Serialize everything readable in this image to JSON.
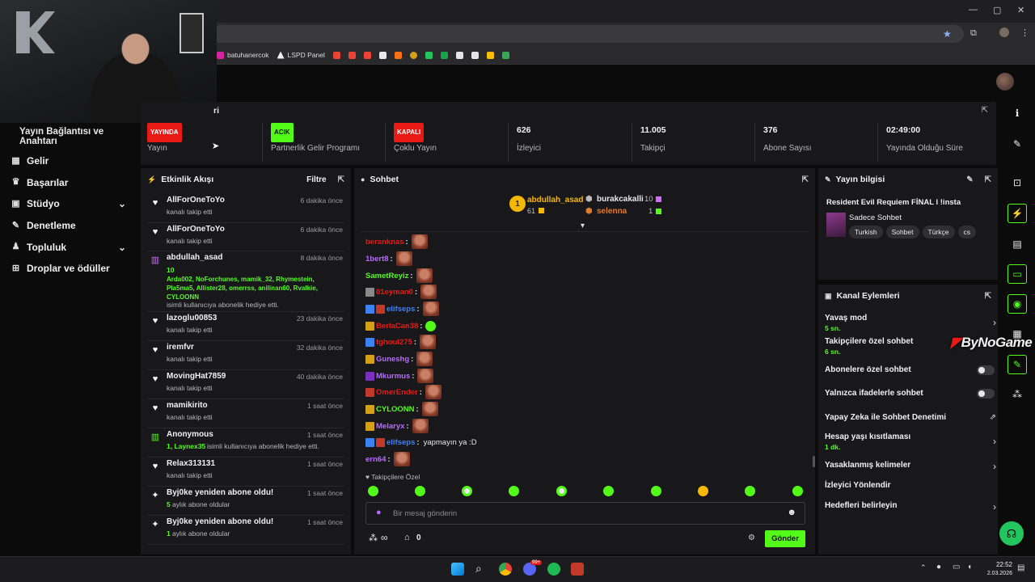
{
  "browser": {
    "bookmarks": [
      "batuhanercok",
      "LSPD Panel"
    ]
  },
  "sidebar": {
    "header": "Yayın Bağlantısı ve Anahtarı",
    "items": [
      {
        "label": "Gelir",
        "icon": "revenue-icon"
      },
      {
        "label": "Başarılar",
        "icon": "trophy-icon"
      },
      {
        "label": "Stüdyo",
        "icon": "studio-icon",
        "expandable": true
      },
      {
        "label": "Denetleme",
        "icon": "wrench-icon"
      },
      {
        "label": "Topluluk",
        "icon": "community-icon",
        "expandable": true
      },
      {
        "label": "Droplar ve ödüller",
        "icon": "gift-icon"
      }
    ]
  },
  "stats": {
    "header_partial": "ri",
    "items": [
      {
        "badge": "YAYINDA",
        "badge_color": "#e91916",
        "label": "Yayın"
      },
      {
        "badge": "ACIK",
        "badge_color": "#53fc18",
        "label": "Partnerlik Gelir Programı"
      },
      {
        "badge": "KAPALI",
        "badge_color": "#e91916",
        "label": "Çoklu Yayın"
      },
      {
        "value": "626",
        "label": "İzleyici"
      },
      {
        "value": "11.005",
        "label": "Takipçi"
      },
      {
        "value": "376",
        "label": "Abone Sayısı"
      },
      {
        "value": "02:49:00",
        "label": "Yayında Olduğu Süre"
      }
    ]
  },
  "activity": {
    "title": "Etkinlik Akışı",
    "filter": "Filtre",
    "items": [
      {
        "name": "AllForOneToYo",
        "time": "6 dakika önce",
        "sub": "kanalı takip etti",
        "icon": "heart-icon"
      },
      {
        "name": "AllForOneToYo",
        "time": "6 dakika önce",
        "sub": "kanalı takip etti",
        "icon": "heart-icon"
      },
      {
        "name": "abdullah_asad",
        "time": "8 dakika önce",
        "count": "10",
        "names": "Arda002, NoForchunes, mamik_32, Rhymestein, Pla5ma5, Allister28, omerrss, anilinan60, Rvalkie, CYLOONN",
        "sub": "isimli kullanıcıya abonelik hediye etti.",
        "icon": "gift-icon"
      },
      {
        "name": "lazoglu00853",
        "time": "23 dakika önce",
        "sub": "kanalı takip etti",
        "icon": "heart-icon"
      },
      {
        "name": "iremfvr",
        "time": "32 dakika önce",
        "sub": "kanalı takip etti",
        "icon": "heart-icon"
      },
      {
        "name": "MovingHat7859",
        "time": "40 dakika önce",
        "sub": "kanalı takip etti",
        "icon": "heart-icon"
      },
      {
        "name": "mamikirito",
        "time": "1 saat önce",
        "sub": "kanalı takip etti",
        "icon": "heart-icon"
      },
      {
        "name": "Anonymous",
        "time": "1 saat önce",
        "highlight": "1, Laynex35",
        "sub": "isimli kullanıcıya abonelik hediye etti.",
        "icon": "gift-icon"
      },
      {
        "name": "Relax313131",
        "time": "1 saat önce",
        "sub": "kanalı takip etti",
        "icon": "heart-icon"
      },
      {
        "name": "Byj0ke yeniden abone oldu!",
        "time": "1 saat önce",
        "highlight": "5",
        "sub": "aylık abone oldular",
        "icon": "sparkle-icon"
      },
      {
        "name": "Byj0ke yeniden abone oldu!",
        "time": "1 saat önce",
        "highlight": "1",
        "sub": "aylık abone oldular",
        "icon": "sparkle-icon"
      }
    ]
  },
  "chat": {
    "title": "Sohbet",
    "leaders": [
      {
        "rank": "1",
        "name": "abdullah_asad",
        "count": "61"
      },
      {
        "name": "burakcakalli",
        "count": "10"
      },
      {
        "name": "selenna",
        "count": "1"
      }
    ],
    "messages": [
      {
        "user": "beranknas",
        "color": "#e91916",
        "emote": true
      },
      {
        "user": "1bert8",
        "color": "#b66bff",
        "emote": true
      },
      {
        "user": "SametReyiz",
        "color": "#53fc18",
        "emote": true
      },
      {
        "user": "01eyman0",
        "color": "#e91916",
        "emote": true,
        "badges": [
          "#8a8a8a"
        ]
      },
      {
        "user": "elifseps",
        "color": "#3b82f6",
        "emote": true,
        "badges": [
          "#3b82f6",
          "#c0392b"
        ]
      },
      {
        "user": "BerlaCan38",
        "color": "#e91916",
        "emote": true,
        "badges": [
          "#d4a017"
        ]
      },
      {
        "user": "tghoul275",
        "color": "#e91916",
        "emote": true,
        "badges": [
          "#3b82f6"
        ]
      },
      {
        "user": "Guneshg",
        "color": "#b66bff",
        "emote": true,
        "badges": [
          "#d4a017"
        ]
      },
      {
        "user": "Mkurmus",
        "color": "#b66bff",
        "emote": true,
        "badges": [
          "#7b2fbe"
        ]
      },
      {
        "user": "OmerEnder",
        "color": "#e91916",
        "emote": true,
        "badges": [
          "#c0392b"
        ]
      },
      {
        "user": "CYLOONN",
        "color": "#53fc18",
        "emote": true,
        "badges": [
          "#d4a017"
        ]
      },
      {
        "user": "Melaryx",
        "color": "#b66bff",
        "emote": true,
        "badges": [
          "#d4a017"
        ]
      },
      {
        "user": "elifseps",
        "color": "#3b82f6",
        "message": "yapmayın ya :D",
        "badges": [
          "#3b82f6",
          "#c0392b"
        ]
      },
      {
        "user": "ern64",
        "color": "#b66bff",
        "emote": true
      }
    ],
    "followers_only": "Takipçilere Özel",
    "placeholder": "Bir mesaj gönderin",
    "counter_inf": "∞",
    "counter_zero": "0",
    "send": "Gönder"
  },
  "stream_info": {
    "title": "Yayın bilgisi",
    "stream_title": "Resident Evil Requiem FİNAL l !insta",
    "category": "Sadece Sohbet",
    "tags": [
      "Turkish",
      "Sohbet",
      "Türkçe",
      "cs"
    ]
  },
  "channel_actions": {
    "title": "Kanal Eylemleri",
    "watermark": "ByNoGame",
    "items": [
      {
        "label": "Yavaş mod",
        "sub": "5 sn.",
        "control": "chevron"
      },
      {
        "label": "Takipçilere özel sohbet",
        "sub": "6 sn.",
        "control": "none"
      },
      {
        "label": "Abonelere özel sohbet",
        "control": "toggle"
      },
      {
        "label": "Yalnızca ifadelerle sohbet",
        "control": "toggle"
      },
      {
        "label": "Yapay Zeka ile Sohbet Denetimi",
        "control": "external"
      },
      {
        "label": "Hesap yaşı kısıtlaması",
        "sub": "1 dk.",
        "control": "chevron"
      },
      {
        "label": "Yasaklanmış kelimeler",
        "control": "chevron"
      },
      {
        "label": "İzleyici Yönlendir",
        "control": "none"
      },
      {
        "label": "Hedefleri belirleyin",
        "control": "chevron"
      }
    ]
  },
  "taskbar": {
    "time": "22:52",
    "date": "2.03.2026",
    "discord_badge": "99+"
  },
  "colors": {
    "accent": "#53fc18",
    "live": "#e91916",
    "panel": "#18181b"
  }
}
